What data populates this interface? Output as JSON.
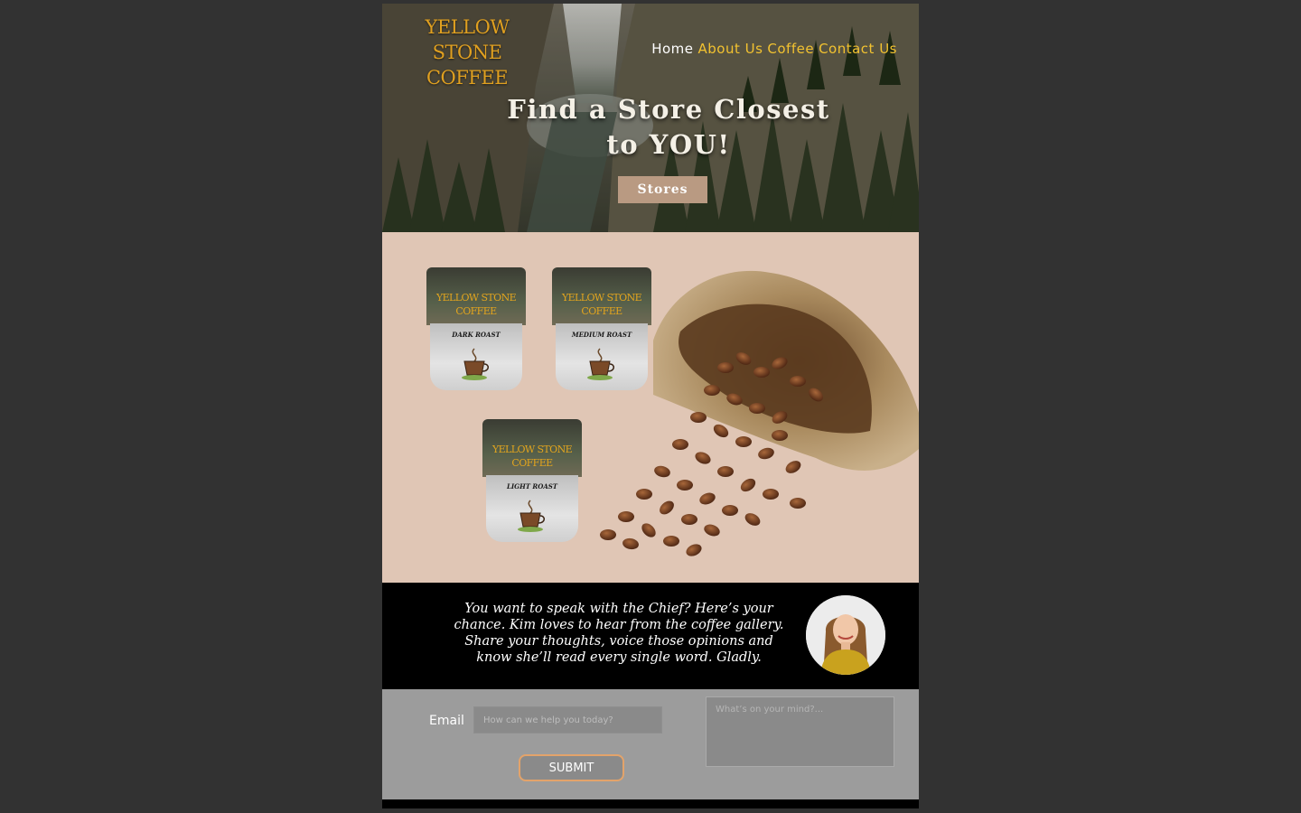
{
  "brand": {
    "line1": "YELLOW STONE",
    "line2": "COFFEE"
  },
  "nav": [
    {
      "label": "Home",
      "active": true
    },
    {
      "label": "About Us",
      "active": false
    },
    {
      "label": "Coffee",
      "active": false
    },
    {
      "label": "Contact Us",
      "active": false
    }
  ],
  "hero": {
    "title_line1": "Find a Store Closest",
    "title_line2": "to YOU!",
    "button_label": "Stores",
    "image": "waterfall-canyon-background"
  },
  "products": [
    {
      "brand_line1": "YELLOW STONE",
      "brand_line2": "COFFEE",
      "roast": "DARK ROAST",
      "icon": "coffee-cup-icon"
    },
    {
      "brand_line1": "YELLOW STONE",
      "brand_line2": "COFFEE",
      "roast": "MEDIUM ROAST",
      "icon": "coffee-cup-icon"
    },
    {
      "brand_line1": "YELLOW STONE",
      "brand_line2": "COFFEE",
      "roast": "LIGHT ROAST",
      "icon": "coffee-cup-icon"
    }
  ],
  "products_image": "burlap-sack-coffee-beans",
  "chief": {
    "message": "You want to speak with the Chief? Here’s your chance. Kim loves to hear from the coffee gallery. Share your thoughts, voice those opinions and know she’ll read every single word. Gladly.",
    "avatar": "woman-portrait-avatar"
  },
  "contact_form": {
    "email_label": "Email",
    "email_placeholder": "How can we help you today?",
    "message_placeholder": "What’s on your mind?...",
    "submit_label": "SUBMIT"
  },
  "colors": {
    "background": "#323232",
    "brand_gold": "#e0a020",
    "nav_gold": "#f2c230",
    "stores_button": "#b99a82",
    "products_bg": "#e0c6b5",
    "form_bg": "#9c9c9c",
    "submit_border": "#e3a36a"
  }
}
